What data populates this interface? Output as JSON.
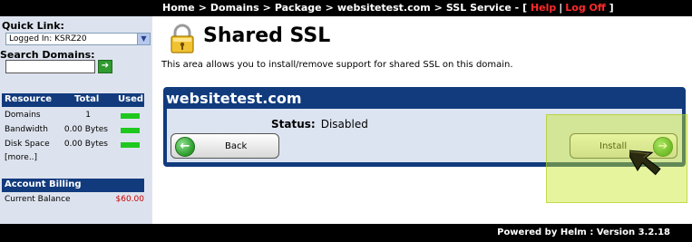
{
  "breadcrumb": {
    "items": [
      "Home",
      "Domains",
      "Package",
      "websitetest.com",
      "SSL Service"
    ],
    "separator": ">",
    "help_label": "Help",
    "logoff_label": "Log Off",
    "bracket_open": "[",
    "bracket_close": "]",
    "divider": "|",
    "dash": "-"
  },
  "sidebar": {
    "quick_link_title": "Quick Link:",
    "quick_link_value": "Logged In: KSRZ20",
    "search_title": "Search Domains:",
    "search_value": "",
    "resources": {
      "headers": [
        "Resource",
        "Total",
        "Used"
      ],
      "rows": [
        {
          "name": "Domains",
          "total": "1"
        },
        {
          "name": "Bandwidth",
          "total": "0.00 Bytes"
        },
        {
          "name": "Disk Space",
          "total": "0.00 Bytes"
        }
      ],
      "more_label": "[more..]"
    },
    "billing": {
      "title": "Account Billing",
      "balance_label": "Current Balance",
      "balance_value": "$60.00"
    }
  },
  "main": {
    "title": "Shared SSL",
    "description": "This area allows you to install/remove support for shared SSL on this domain.",
    "panel": {
      "domain": "websitetest.com",
      "status_label": "Status:",
      "status_value": "Disabled",
      "back_label": "Back",
      "install_label": "Install"
    }
  },
  "footer": {
    "powered_label": "Powered by Helm",
    "version_label": "Version 3.2.18",
    "separator": ":"
  },
  "colors": {
    "accent_blue": "#123b7e",
    "panel_bg": "#dce4f1",
    "sidebar_bg": "#dde3ee",
    "link_red": "#ff2a2a",
    "usage_green": "#1ec81e",
    "highlight": "#c8e628"
  },
  "icons": {
    "lock": "padlock-key-icon",
    "back": "green-arrow-left-icon",
    "install": "green-arrow-right-icon",
    "go": "green-arrow-right-icon",
    "dropdown": "chevron-down-icon",
    "cursor": "mouse-cursor-icon"
  }
}
